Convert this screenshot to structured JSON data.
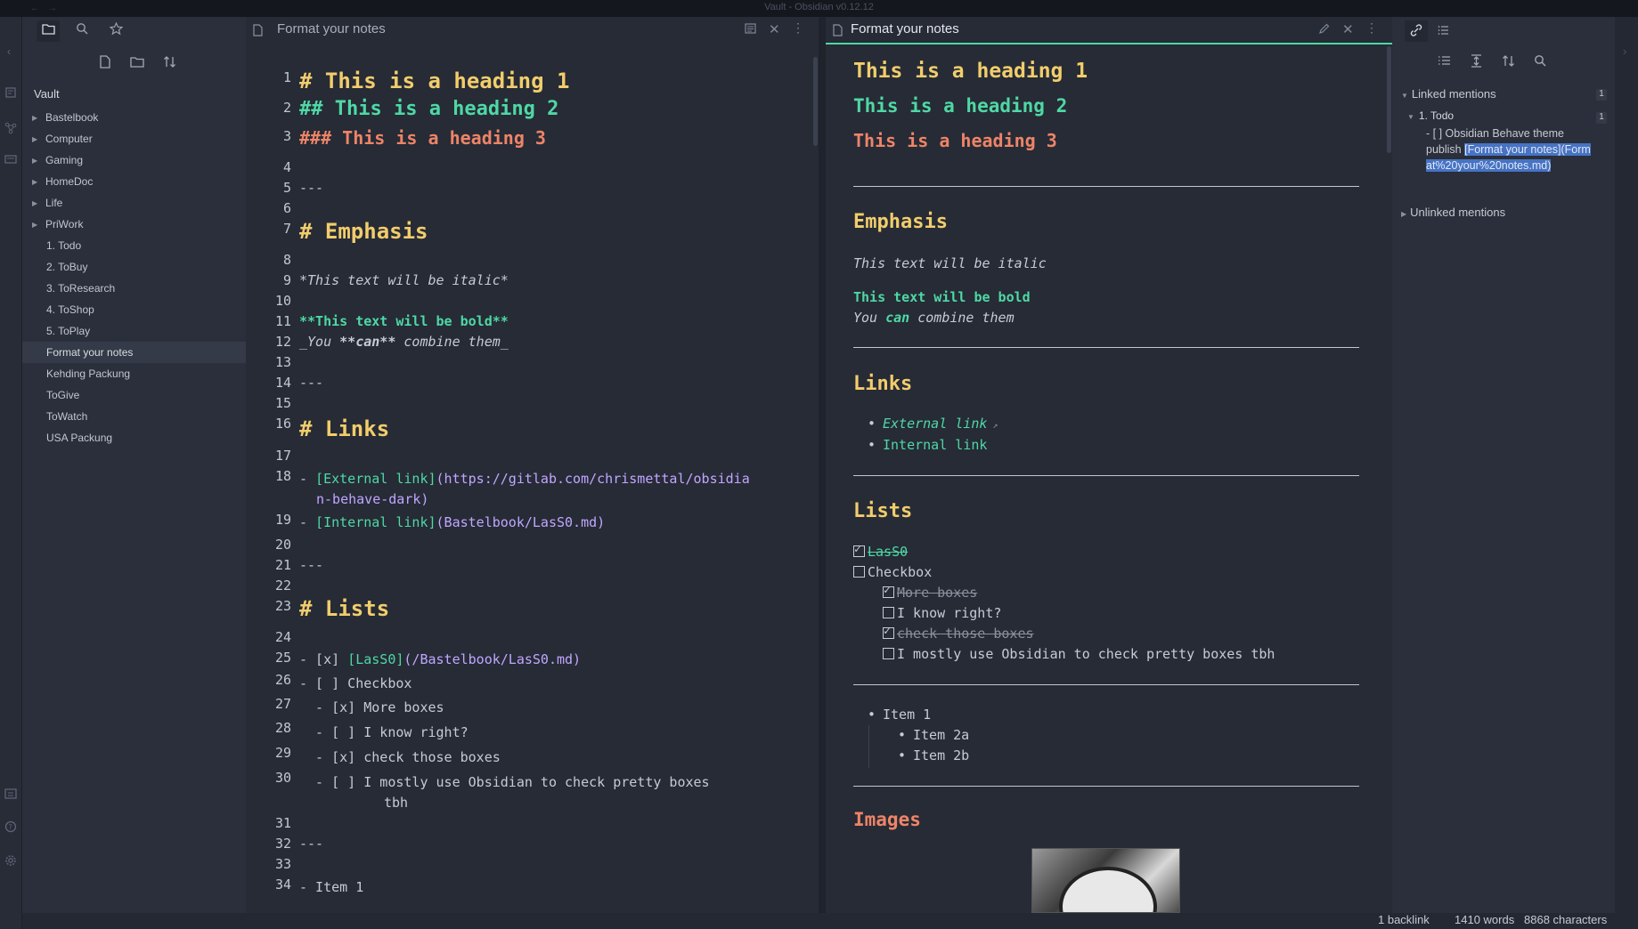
{
  "window": {
    "title": "Vault - Obsidian v0.12.12"
  },
  "explorer": {
    "tab_icons": [
      "folder-icon",
      "search-icon",
      "star-icon"
    ],
    "action_icons": [
      "new-note-icon",
      "new-folder-icon",
      "sort-icon"
    ],
    "vault_name": "Vault",
    "folders": [
      "Bastelbook",
      "Computer",
      "Gaming",
      "HomeDoc",
      "Life",
      "PriWork"
    ],
    "files": [
      "1. Todo",
      "2. ToBuy",
      "3. ToResearch",
      "4. ToShop",
      "5. ToPlay",
      "Format your notes",
      "Kehding Packung",
      "ToGive",
      "ToWatch",
      "USA Packung"
    ],
    "active_file": "Format your notes"
  },
  "editor": {
    "title": "Format your notes",
    "line_numbers": [
      "1",
      "2",
      "3",
      "4",
      "5",
      "6",
      "7",
      "8",
      "9",
      "10",
      "11",
      "12",
      "13",
      "14",
      "15",
      "16",
      "17",
      "18",
      "19",
      "20",
      "21",
      "22",
      "23",
      "24",
      "25",
      "26",
      "27",
      "28",
      "29",
      "30",
      "31",
      "32",
      "33",
      "34"
    ],
    "lines": {
      "l1": "# This is a heading 1",
      "l2": "## This is a heading 2",
      "l3": "### This is a heading 3",
      "l5": "---",
      "l7": "# Emphasis",
      "l9": "*This text will be italic*",
      "l11": "**This text will be bold**",
      "l12_a": "_You ",
      "l12_b": "**can**",
      "l12_c": " combine them_",
      "l14": "---",
      "l16": "# Links",
      "l18_dash": "- ",
      "l18_link": "[External link]",
      "l18_url1": "(https://gitlab.com/chrismettal/obsidia",
      "l18_url2": "n-behave-dark)",
      "l19_dash": "- ",
      "l19_link": "[Internal link]",
      "l19_url": "(Bastelbook/LasS0.md)",
      "l21": "---",
      "l23": "# Lists",
      "l25_a": "- [x] ",
      "l25_link": "[LasS0]",
      "l25_url": "(/Bastelbook/LasS0.md)",
      "l26": "- [ ] Checkbox",
      "l27": "  - [x] More boxes",
      "l28": "  - [ ] I know right?",
      "l29": "  - [x] check those boxes",
      "l30a": "  - [ ] I mostly use Obsidian to check pretty boxes",
      "l30b": "tbh",
      "l32": "---",
      "l34": "- Item 1"
    }
  },
  "preview": {
    "title": "Format your notes",
    "h1": "This is a heading 1",
    "h2": "This is a heading 2",
    "h3": "This is a heading 3",
    "emphasis_heading": "Emphasis",
    "italic_text": "This text will be italic",
    "bold_text": "This text will be bold",
    "combine_a": "You ",
    "combine_b": "can",
    "combine_c": " combine them",
    "links_heading": "Links",
    "external_link": "External link",
    "internal_link": "Internal link",
    "lists_heading": "Lists",
    "checklist": [
      {
        "label": "LasS0",
        "checked": true
      },
      {
        "label": "Checkbox",
        "checked": false
      },
      {
        "label": "More boxes",
        "checked": true
      },
      {
        "label": "I know right?",
        "checked": false
      },
      {
        "label": "check those boxes",
        "checked": true
      },
      {
        "label": "I mostly use Obsidian to check pretty boxes tbh",
        "checked": false
      }
    ],
    "bullets": [
      "Item 1",
      "Item 2a",
      "Item 2b"
    ],
    "images_heading": "Images"
  },
  "backlinks": {
    "linked_mentions_label": "Linked mentions",
    "linked_count": "1",
    "file_label": "1. Todo",
    "file_count": "1",
    "context_text": "- [ ] Obsidian Behave theme publish ",
    "context_highlight": "[Format your notes](Format%20your%20notes.md)",
    "unlinked_mentions_label": "Unlinked mentions"
  },
  "status": {
    "backlinks": "1 backlink",
    "words": "1410 words",
    "characters": "8868 characters"
  },
  "colors": {
    "accent": "#4fd8a4",
    "h1": "#f2cd6b",
    "h3": "#ee8467",
    "url": "#c1a6ff"
  }
}
